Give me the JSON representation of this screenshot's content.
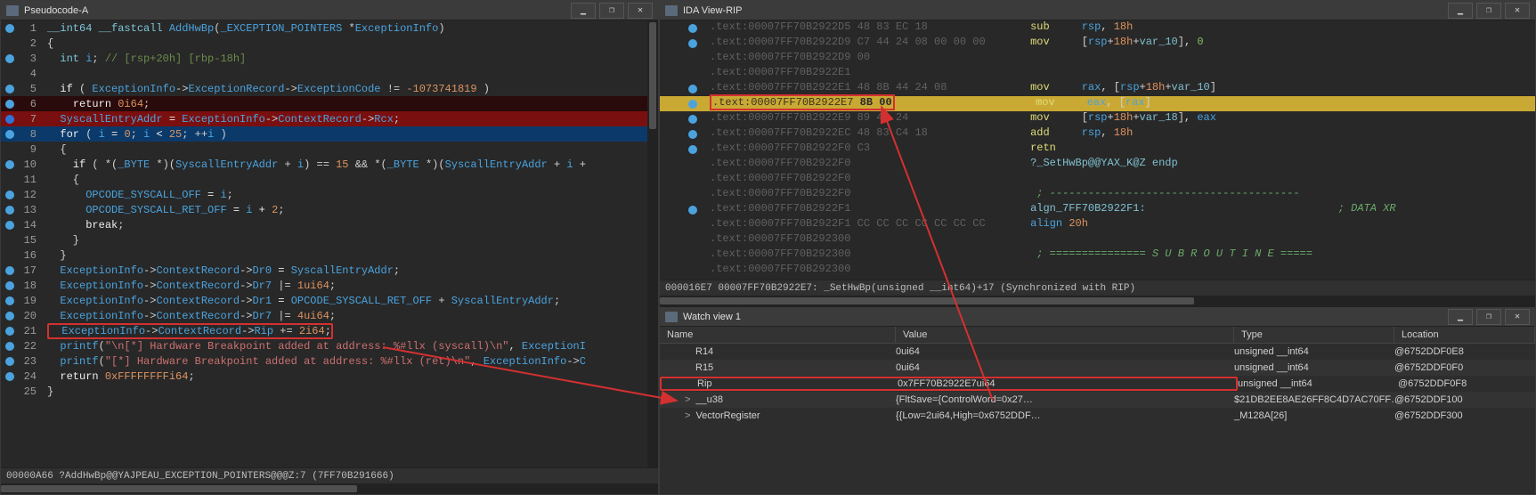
{
  "left_panel": {
    "title": "Pseudocode-A",
    "status": "00000A66 ?AddHwBp@@YAJPEAU_EXCEPTION_POINTERS@@@Z:7 (7FF70B291666)",
    "lines": [
      {
        "n": 1,
        "bp": true,
        "parts": [
          [
            "type",
            "__int64 __fastcall "
          ],
          [
            "ident",
            "AddHwBp"
          ],
          [
            "op",
            "("
          ],
          [
            "ident",
            "_EXCEPTION_POINTERS "
          ],
          [
            "op",
            "*"
          ],
          [
            "ident",
            "ExceptionInfo"
          ],
          [
            "op",
            ")"
          ]
        ]
      },
      {
        "n": 2,
        "parts": [
          [
            "op",
            "{ "
          ]
        ]
      },
      {
        "n": 3,
        "bp": true,
        "parts": [
          [
            "op",
            "  "
          ],
          [
            "type",
            "int "
          ],
          [
            "ident",
            "i"
          ],
          [
            "op",
            "; "
          ],
          [
            "comment",
            "// [rsp+20h] [rbp-18h]"
          ]
        ]
      },
      {
        "n": 4,
        "parts": [
          [
            "op",
            "  "
          ]
        ]
      },
      {
        "n": 5,
        "bp": true,
        "parts": [
          [
            "op",
            "  "
          ],
          [
            "kw",
            "if"
          ],
          [
            "op",
            " ( "
          ],
          [
            "ident",
            "ExceptionInfo"
          ],
          [
            "op",
            "->"
          ],
          [
            "ident",
            "ExceptionRecord"
          ],
          [
            "op",
            "->"
          ],
          [
            "ident",
            "ExceptionCode"
          ],
          [
            "op",
            " != "
          ],
          [
            "num",
            "-1073741819"
          ],
          [
            "op",
            " )"
          ]
        ]
      },
      {
        "n": 6,
        "bp": true,
        "hl": "dark",
        "parts": [
          [
            "op",
            "    "
          ],
          [
            "kw",
            "return"
          ],
          [
            "op",
            " "
          ],
          [
            "num",
            "0i64"
          ],
          [
            "op",
            ";"
          ]
        ]
      },
      {
        "n": 7,
        "bp": "solid",
        "hl": "red",
        "parts": [
          [
            "op",
            "  "
          ],
          [
            "ident",
            "SyscallEntryAddr"
          ],
          [
            "kw",
            " = "
          ],
          [
            "ident",
            "ExceptionInfo"
          ],
          [
            "op",
            "->"
          ],
          [
            "ident",
            "ContextRecord"
          ],
          [
            "op",
            "->"
          ],
          [
            "ident",
            "Rcx"
          ],
          [
            "op",
            ";"
          ]
        ]
      },
      {
        "n": 8,
        "bp": true,
        "hl": "blue",
        "parts": [
          [
            "op",
            "  "
          ],
          [
            "kw",
            "for"
          ],
          [
            "op",
            " ( "
          ],
          [
            "ident",
            "i"
          ],
          [
            "kw",
            " = "
          ],
          [
            "num",
            "0"
          ],
          [
            "op",
            "; "
          ],
          [
            "ident",
            "i "
          ],
          [
            "kw",
            "< "
          ],
          [
            "num",
            "25"
          ],
          [
            "op",
            "; ++"
          ],
          [
            "ident",
            "i"
          ],
          [
            "op",
            " )"
          ]
        ]
      },
      {
        "n": 9,
        "parts": [
          [
            "op",
            "  {"
          ]
        ]
      },
      {
        "n": 10,
        "bp": true,
        "parts": [
          [
            "op",
            "    "
          ],
          [
            "kw",
            "if"
          ],
          [
            "op",
            " ( *("
          ],
          [
            "ident",
            "_BYTE"
          ],
          [
            "op",
            " *)("
          ],
          [
            "ident",
            "SyscallEntryAddr"
          ],
          [
            "op",
            " + "
          ],
          [
            "ident",
            "i"
          ],
          [
            "op",
            ") == "
          ],
          [
            "num",
            "15"
          ],
          [
            "op",
            " && *("
          ],
          [
            "ident",
            "_BYTE"
          ],
          [
            "op",
            " *)("
          ],
          [
            "ident",
            "SyscallEntryAddr"
          ],
          [
            "op",
            " + "
          ],
          [
            "ident",
            "i"
          ],
          [
            "op",
            " + "
          ]
        ]
      },
      {
        "n": 11,
        "parts": [
          [
            "op",
            "    {"
          ]
        ]
      },
      {
        "n": 12,
        "bp": true,
        "parts": [
          [
            "op",
            "      "
          ],
          [
            "ident",
            "OPCODE_SYSCALL_OFF"
          ],
          [
            "kw",
            " = "
          ],
          [
            "ident",
            "i"
          ],
          [
            "op",
            ";"
          ]
        ]
      },
      {
        "n": 13,
        "bp": true,
        "parts": [
          [
            "op",
            "      "
          ],
          [
            "ident",
            "OPCODE_SYSCALL_RET_OFF"
          ],
          [
            "kw",
            " = "
          ],
          [
            "ident",
            "i "
          ],
          [
            "kw",
            "+ "
          ],
          [
            "num",
            "2"
          ],
          [
            "op",
            ";"
          ]
        ]
      },
      {
        "n": 14,
        "bp": true,
        "parts": [
          [
            "op",
            "      "
          ],
          [
            "kw",
            "break"
          ],
          [
            "op",
            ";"
          ]
        ]
      },
      {
        "n": 15,
        "parts": [
          [
            "op",
            "    }"
          ]
        ]
      },
      {
        "n": 16,
        "parts": [
          [
            "op",
            "  }"
          ]
        ]
      },
      {
        "n": 17,
        "bp": true,
        "parts": [
          [
            "op",
            "  "
          ],
          [
            "ident",
            "ExceptionInfo"
          ],
          [
            "op",
            "->"
          ],
          [
            "ident",
            "ContextRecord"
          ],
          [
            "op",
            "->"
          ],
          [
            "ident",
            "Dr0"
          ],
          [
            "kw",
            " = "
          ],
          [
            "ident",
            "SyscallEntryAddr"
          ],
          [
            "op",
            ";"
          ]
        ]
      },
      {
        "n": 18,
        "bp": true,
        "parts": [
          [
            "op",
            "  "
          ],
          [
            "ident",
            "ExceptionInfo"
          ],
          [
            "op",
            "->"
          ],
          [
            "ident",
            "ContextRecord"
          ],
          [
            "op",
            "->"
          ],
          [
            "ident",
            "Dr7"
          ],
          [
            "op",
            " |= "
          ],
          [
            "num",
            "1ui64"
          ],
          [
            "op",
            ";"
          ]
        ]
      },
      {
        "n": 19,
        "bp": true,
        "parts": [
          [
            "op",
            "  "
          ],
          [
            "ident",
            "ExceptionInfo"
          ],
          [
            "op",
            "->"
          ],
          [
            "ident",
            "ContextRecord"
          ],
          [
            "op",
            "->"
          ],
          [
            "ident",
            "Dr1"
          ],
          [
            "kw",
            " = "
          ],
          [
            "ident",
            "OPCODE_SYSCALL_RET_OFF"
          ],
          [
            "op",
            " + "
          ],
          [
            "ident",
            "SyscallEntryAddr"
          ],
          [
            "op",
            ";"
          ]
        ]
      },
      {
        "n": 20,
        "bp": true,
        "parts": [
          [
            "op",
            "  "
          ],
          [
            "ident",
            "ExceptionInfo"
          ],
          [
            "op",
            "->"
          ],
          [
            "ident",
            "ContextRecord"
          ],
          [
            "op",
            "->"
          ],
          [
            "ident",
            "Dr7"
          ],
          [
            "op",
            " |= "
          ],
          [
            "num",
            "4ui64"
          ],
          [
            "op",
            ";"
          ]
        ]
      },
      {
        "n": 21,
        "bp": true,
        "box": true,
        "parts": [
          [
            "op",
            "  "
          ],
          [
            "ident",
            "ExceptionInfo"
          ],
          [
            "op",
            "->"
          ],
          [
            "ident",
            "ContextRecord"
          ],
          [
            "op",
            "->"
          ],
          [
            "ident",
            "Rip"
          ],
          [
            "op",
            " += "
          ],
          [
            "num",
            "2i64"
          ],
          [
            "op",
            ";"
          ]
        ]
      },
      {
        "n": 22,
        "bp": true,
        "parts": [
          [
            "op",
            "  "
          ],
          [
            "ident",
            "printf"
          ],
          [
            "op",
            "("
          ],
          [
            "str",
            "\"\\n[*] Hardware Breakpoint added at address: %#llx (syscall)\\n\""
          ],
          [
            "op",
            ", "
          ],
          [
            "ident",
            "ExceptionI"
          ]
        ]
      },
      {
        "n": 23,
        "bp": true,
        "parts": [
          [
            "op",
            "  "
          ],
          [
            "ident",
            "printf"
          ],
          [
            "op",
            "("
          ],
          [
            "str",
            "\"[*] Hardware Breakpoint added at address: %#llx (ret)\\n\""
          ],
          [
            "op",
            ", "
          ],
          [
            "ident",
            "ExceptionInfo"
          ],
          [
            "op",
            "->"
          ],
          [
            "ident",
            "C"
          ]
        ]
      },
      {
        "n": 24,
        "bp": true,
        "parts": [
          [
            "op",
            "  "
          ],
          [
            "kw",
            "return"
          ],
          [
            "op",
            " "
          ],
          [
            "num",
            "0xFFFFFFFFi64"
          ],
          [
            "op",
            ";"
          ]
        ]
      },
      {
        "n": 25,
        "parts": [
          [
            "op",
            "}"
          ]
        ]
      }
    ]
  },
  "ida_panel": {
    "title": "IDA View-RIP",
    "status": "000016E7 00007FF70B2922E7: _SetHwBp(unsigned __int64)+17 (Synchronized with RIP)",
    "lines": [
      {
        "bp": true,
        "addr": ".text:00007FF70B2922D5",
        "bytes": "48 83 EC 18",
        "mnem": "sub",
        "ops": [
          [
            "reg",
            "rsp"
          ],
          [
            "op",
            ", "
          ],
          [
            "imm",
            "18h"
          ]
        ]
      },
      {
        "bp": true,
        "addr": ".text:00007FF70B2922D9",
        "bytes": "C7 44 24 08 00 00 00",
        "mnem": "mov",
        "ops": [
          [
            "op",
            "["
          ],
          [
            "reg",
            "rsp"
          ],
          [
            "op",
            "+"
          ],
          [
            "imm",
            "18h"
          ],
          [
            "op",
            "+"
          ],
          [
            "ident",
            "var_10"
          ],
          [
            "op",
            "], "
          ],
          [
            "num",
            "0"
          ]
        ]
      },
      {
        "addr": ".text:00007FF70B2922D9",
        "bytes": "00"
      },
      {
        "addr": ".text:00007FF70B2922E1",
        "bytes": "",
        "comment": ""
      },
      {
        "bp": true,
        "addr": ".text:00007FF70B2922E1",
        "bytes": "48 8B 44 24 08",
        "mnem": "mov",
        "ops": [
          [
            "reg",
            "rax"
          ],
          [
            "op",
            ", ["
          ],
          [
            "reg",
            "rsp"
          ],
          [
            "op",
            "+"
          ],
          [
            "imm",
            "18h"
          ],
          [
            "op",
            "+"
          ],
          [
            "ident",
            "var_10"
          ],
          [
            "op",
            "]"
          ]
        ]
      },
      {
        "bp": true,
        "hl": true,
        "addr": ".text:00007FF70B2922E7",
        "bytes": "8B 00",
        "mnem": "mov",
        "ops": [
          [
            "reg",
            "eax"
          ],
          [
            "op",
            ", "
          ],
          [
            "op",
            "["
          ],
          [
            "reg",
            "rax"
          ],
          [
            "op",
            "]"
          ]
        ]
      },
      {
        "bp": true,
        "addr": ".text:00007FF70B2922E9",
        "bytes": "89 44 24",
        "mnem": "mov",
        "ops": [
          [
            "op",
            "["
          ],
          [
            "reg",
            "rsp"
          ],
          [
            "op",
            "+"
          ],
          [
            "imm",
            "18h"
          ],
          [
            "op",
            "+"
          ],
          [
            "ident",
            "var_18"
          ],
          [
            "op",
            "], "
          ],
          [
            "reg",
            "eax"
          ]
        ]
      },
      {
        "bp": true,
        "addr": ".text:00007FF70B2922EC",
        "bytes": "48 83 C4 18",
        "mnem": "add",
        "ops": [
          [
            "reg",
            "rsp"
          ],
          [
            "op",
            ", "
          ],
          [
            "imm",
            "18h"
          ]
        ]
      },
      {
        "bp": true,
        "addr": ".text:00007FF70B2922F0",
        "bytes": "C3",
        "mnem": "retn"
      },
      {
        "addr": ".text:00007FF70B2922F0",
        "label": "?_SetHwBp@@YAX_K@Z endp"
      },
      {
        "addr": ".text:00007FF70B2922F0"
      },
      {
        "addr": ".text:00007FF70B2922F0",
        "comment": "; ---------------------------------------"
      },
      {
        "bp": true,
        "addr": ".text:00007FF70B2922F1",
        "label": "algn_7FF70B2922F1:",
        "trail": "; DATA XR"
      },
      {
        "addr": ".text:00007FF70B2922F1",
        "bytes": "CC CC CC CC CC CC CC",
        "mnem2": "align",
        "ops": [
          [
            "imm",
            "20h"
          ]
        ]
      },
      {
        "addr": ".text:00007FF70B292300"
      },
      {
        "addr": ".text:00007FF70B292300",
        "comment": "; =============== S U B R O U T I N E ====="
      },
      {
        "addr": ".text:00007FF70B292300"
      }
    ]
  },
  "watch_panel": {
    "title": "Watch view 1",
    "headers": {
      "name": "Name",
      "value": "Value",
      "type": "Type",
      "location": "Location"
    },
    "rows": [
      {
        "name": "R14",
        "value": "0ui64",
        "type": "unsigned __int64",
        "location": "@6752DDF0E8"
      },
      {
        "name": "R15",
        "value": "0ui64",
        "type": "unsigned __int64",
        "location": "@6752DDF0F0"
      },
      {
        "name": "Rip",
        "value": "0x7FF70B2922E7ui64",
        "type": "unsigned __int64",
        "location": "@6752DDF0F8",
        "box": true
      },
      {
        "name": "__u38",
        "value": "{FltSave={ControlWord=0x27…",
        "type": "$21DB2EE8AE26FF8C4D7AC70FF…",
        "location": "@6752DDF100",
        "expand": ">"
      },
      {
        "name": "VectorRegister",
        "value": "{{Low=2ui64,High=0x6752DDF…",
        "type": "_M128A[26]",
        "location": "@6752DDF300",
        "expand": ">"
      }
    ]
  }
}
